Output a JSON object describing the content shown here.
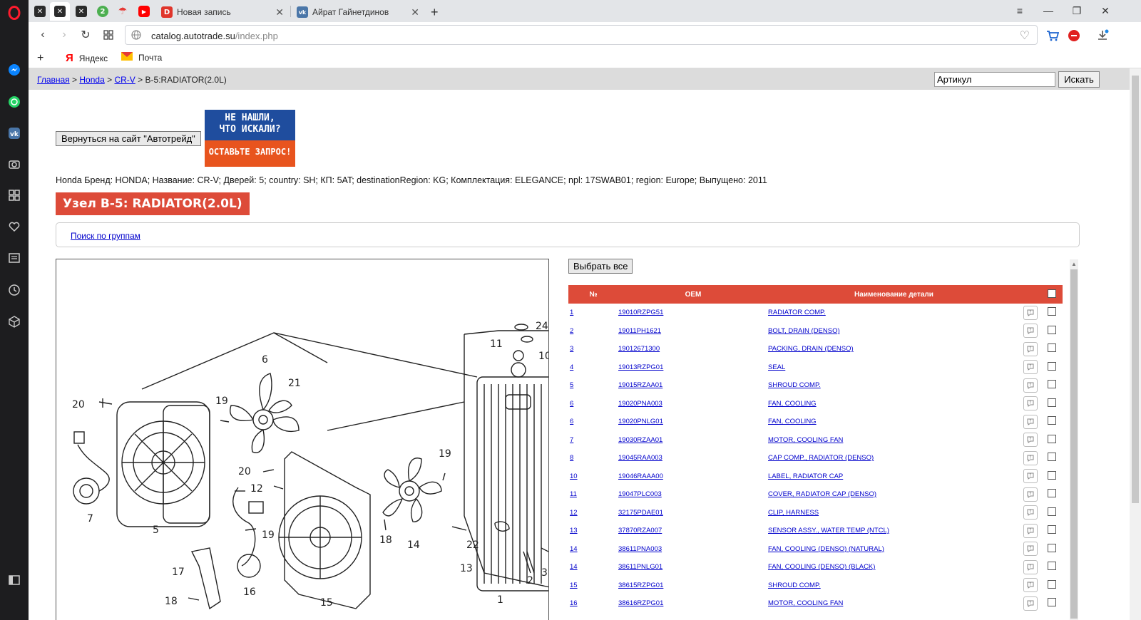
{
  "browser": {
    "tabs": [
      {
        "title": "Новая запись",
        "icon": "dzen-icon",
        "color": "#e0352b"
      },
      {
        "title": "Айрат Гайнетдинов",
        "icon": "vk-icon",
        "color": "#4a76a8"
      }
    ],
    "new_tab": "+",
    "address": {
      "domain": "catalog.autotrade.su",
      "path": "/index.php"
    },
    "bookmarks": [
      {
        "label": "Яндекс",
        "icon": "yandex-icon"
      },
      {
        "label": "Почта",
        "icon": "mail-icon"
      }
    ]
  },
  "page": {
    "breadcrumb": {
      "home": "Главная",
      "sep": ">",
      "brand": "Honda",
      "model": "CR-V",
      "current": "B-5:RADIATOR(2.0L)"
    },
    "search": {
      "placeholder": "Артикул",
      "button": "Искать"
    },
    "back_button": "Вернуться на сайт \"Автотрейд\"",
    "banner": {
      "line1": "НЕ НАШЛИ,",
      "line2": "ЧТО ИСКАЛИ?",
      "line3": "ОСТАВЬТЕ ЗАПРОС!"
    },
    "car_info": "Honda Бренд: HONDA; Название: CR-V; Дверей: 5; country: SH; КП: 5AT; destinationRegion: KG; Комплектация: ELEGANCE; npl: 17SWAB01; region: Europe; Выпущено: 2011",
    "node_title": "Узел B-5: RADIATOR(2.0L)",
    "groups_link": "Поиск по группам",
    "select_all": "Выбрать все",
    "table": {
      "headers": {
        "num": "№",
        "oem": "OEM",
        "name": "Наименование детали"
      },
      "rows": [
        {
          "num": "1",
          "oem": "19010RZPG51",
          "name": "RADIATOR COMP."
        },
        {
          "num": "2",
          "oem": "19011PH1621",
          "name": "BOLT, DRAIN (DENSO)"
        },
        {
          "num": "3",
          "oem": "19012671300",
          "name": "PACKING, DRAIN (DENSO)"
        },
        {
          "num": "4",
          "oem": "19013RZPG01",
          "name": "SEAL"
        },
        {
          "num": "5",
          "oem": "19015RZAA01",
          "name": "SHROUD COMP."
        },
        {
          "num": "6",
          "oem": "19020PNA003",
          "name": "FAN, COOLING"
        },
        {
          "num": "6",
          "oem": "19020PNLG01",
          "name": "FAN, COOLING"
        },
        {
          "num": "7",
          "oem": "19030RZAA01",
          "name": "MOTOR, COOLING FAN"
        },
        {
          "num": "8",
          "oem": "19045RAA003",
          "name": "CAP COMP., RADIATOR (DENSO)"
        },
        {
          "num": "10",
          "oem": "19046RAAA00",
          "name": "LABEL, RADIATOR CAP"
        },
        {
          "num": "11",
          "oem": "19047PLC003",
          "name": "COVER, RADIATOR CAP (DENSO)"
        },
        {
          "num": "12",
          "oem": "32175PDAE01",
          "name": "CLIP, HARNESS"
        },
        {
          "num": "13",
          "oem": "37870RZA007",
          "name": "SENSOR ASSY., WATER TEMP (NTCL)"
        },
        {
          "num": "14",
          "oem": "38611PNA003",
          "name": "FAN, COOLING (DENSO) (NATURAL)"
        },
        {
          "num": "14",
          "oem": "38611PNLG01",
          "name": "FAN, COOLING (DENSO) (BLACK)"
        },
        {
          "num": "15",
          "oem": "38615RZPG01",
          "name": "SHROUD COMP."
        },
        {
          "num": "16",
          "oem": "38616RZPG01",
          "name": "MOTOR, COOLING FAN"
        }
      ]
    },
    "diagram_labels": [
      "24",
      "11",
      "10",
      "6",
      "21",
      "20",
      "19",
      "7",
      "5",
      "20",
      "12",
      "19",
      "19",
      "18",
      "14",
      "22",
      "13",
      "2",
      "3",
      "17",
      "16",
      "18",
      "15",
      "1"
    ]
  },
  "colors": {
    "accent_red": "#dd4b39",
    "link": "#0000cc"
  }
}
